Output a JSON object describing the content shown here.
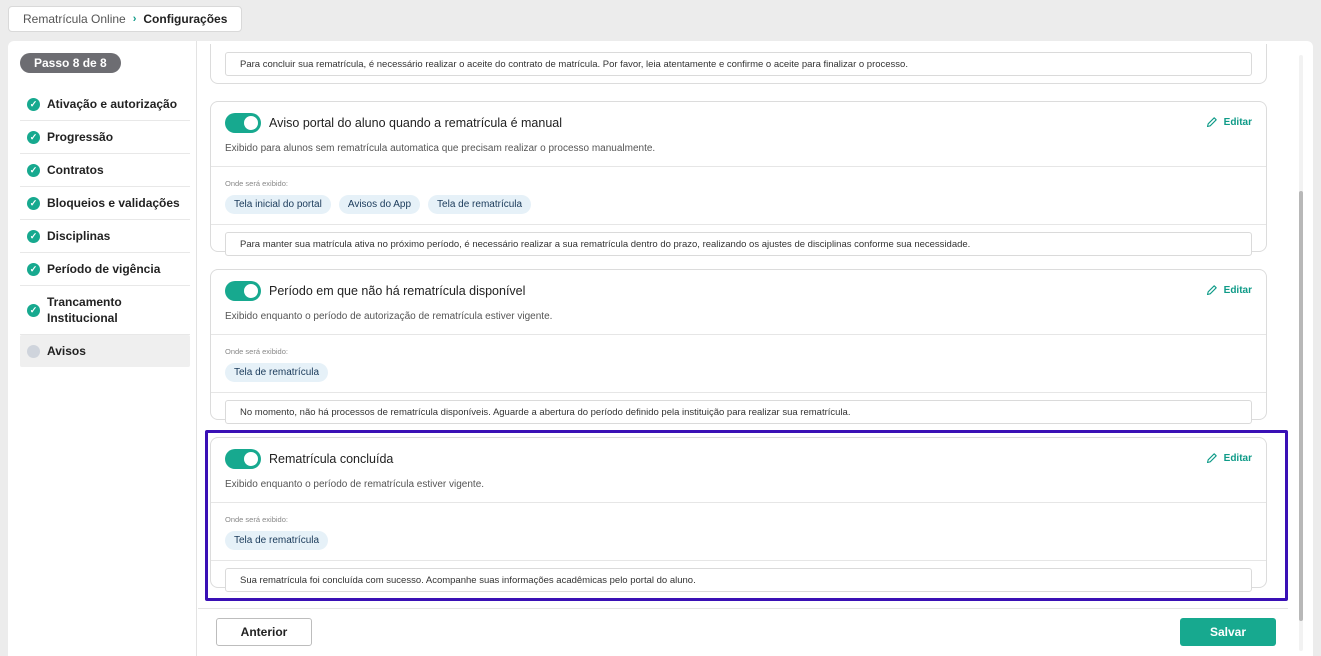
{
  "breadcrumb": {
    "root": "Rematrícula Online",
    "separator": "›",
    "current": "Configurações"
  },
  "sidebar": {
    "step": "Passo 8 de 8",
    "items": [
      {
        "label": "Ativação e autorização",
        "done": true
      },
      {
        "label": "Progressão",
        "done": true
      },
      {
        "label": "Contratos",
        "done": true
      },
      {
        "label": "Bloqueios e validações",
        "done": true
      },
      {
        "label": "Disciplinas",
        "done": true
      },
      {
        "label": "Período de vigência",
        "done": true
      },
      {
        "label": "Trancamento Institucional",
        "done": true
      },
      {
        "label": "Avisos",
        "done": false,
        "active": true
      }
    ]
  },
  "common": {
    "edit_label": "Editar",
    "where_label": "Onde será exibido:"
  },
  "cards": [
    {
      "message": "Para concluir sua rematrícula, é necessário realizar o aceite do contrato de matrícula. Por favor, leia atentamente e confirme o aceite para finalizar o processo."
    },
    {
      "enabled": true,
      "title": "Aviso portal do aluno quando a rematrícula é manual",
      "description": "Exibido para alunos sem rematrícula automatica que precisam realizar o processo manualmente.",
      "chips": [
        "Tela inicial do portal",
        "Avisos do App",
        "Tela de rematrícula"
      ],
      "message": "Para manter sua matrícula ativa no próximo período, é necessário realizar a sua rematrícula dentro do prazo, realizando os ajustes de disciplinas conforme sua necessidade."
    },
    {
      "enabled": true,
      "title": "Período em que não há rematrícula disponível",
      "description": "Exibido enquanto o período de autorização de rematrícula estiver vigente.",
      "chips": [
        "Tela de rematrícula"
      ],
      "message": "No momento, não há processos de rematrícula disponíveis. Aguarde a abertura do período definido pela instituição para realizar sua rematrícula."
    },
    {
      "enabled": true,
      "title": "Rematrícula concluída",
      "description": "Exibido enquanto o período de rematrícula estiver vigente.",
      "chips": [
        "Tela de rematrícula"
      ],
      "message": "Sua rematrícula foi concluída com sucesso. Acompanhe suas informações acadêmicas pelo portal do aluno."
    }
  ],
  "footer": {
    "prev_label": "Anterior",
    "save_label": "Salvar"
  },
  "colors": {
    "accent": "#17a98f",
    "highlight": "#3a10b5",
    "chip_bg": "#e6f1f8"
  }
}
